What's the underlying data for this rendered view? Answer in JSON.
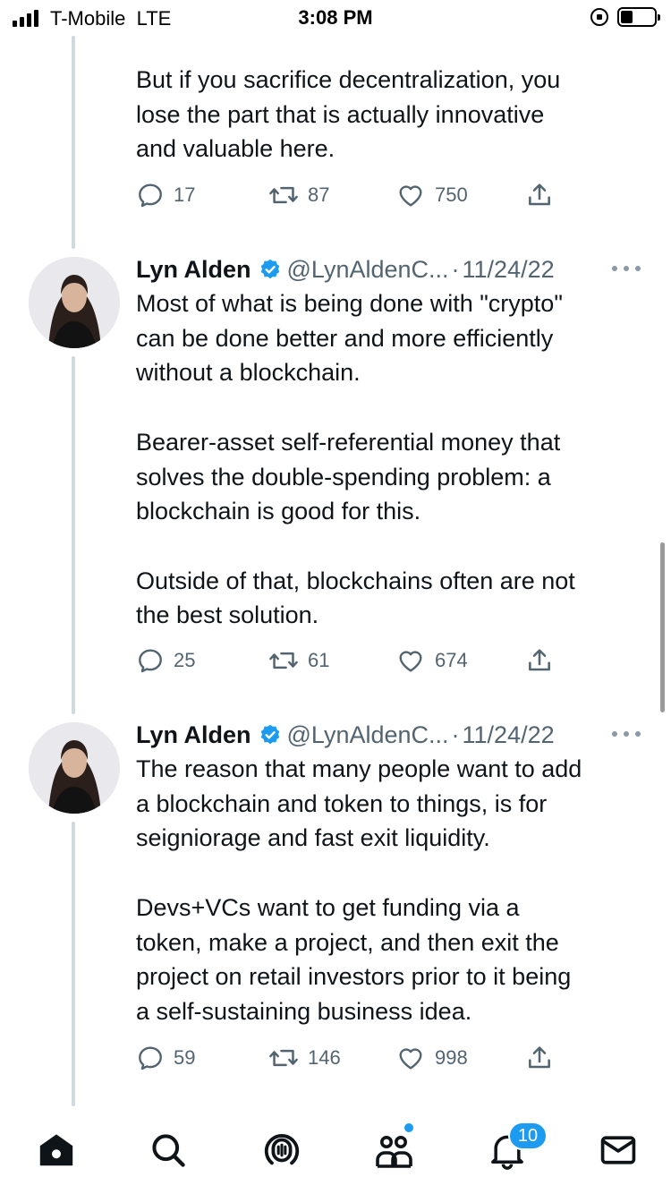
{
  "status_bar": {
    "carrier": "T-Mobile",
    "network": "LTE",
    "time": "3:08 PM"
  },
  "tweets": [
    {
      "text": "But if you sacrifice decentralization, you\nlose the part that is actually innovative\nand valuable here.",
      "replies": "17",
      "retweets": "87",
      "likes": "750"
    },
    {
      "author": "Lyn Alden",
      "handle": "@LynAldenC...",
      "separator": "·",
      "date": "11/24/22",
      "text": "Most of what is being done with \"crypto\"\ncan be done better and more efficiently\nwithout a blockchain.\n\nBearer-asset self-referential money that\nsolves the double-spending problem: a\nblockchain is good for this.\n\nOutside of that, blockchains often are not\nthe best solution.",
      "replies": "25",
      "retweets": "61",
      "likes": "674"
    },
    {
      "author": "Lyn Alden",
      "handle": "@LynAldenC...",
      "separator": "·",
      "date": "11/24/22",
      "text": "The reason that many people want to add\na blockchain and token to things, is for\nseigniorage and fast exit liquidity.\n\nDevs+VCs want to get funding via a\ntoken, make a project, and then exit the\nproject on retail investors prior to it being\na self-sustaining business idea.",
      "replies": "59",
      "retweets": "146",
      "likes": "998"
    }
  ],
  "tab_bar": {
    "items": [
      "home-icon",
      "search-icon",
      "spaces-icon",
      "communities-icon",
      "notifications-icon",
      "messages-icon"
    ],
    "notifications_badge": "10"
  },
  "colors": {
    "accent": "#1d9bf0",
    "text_primary": "#0f1419",
    "text_secondary": "#536471",
    "thread_line": "#cfd9de"
  }
}
